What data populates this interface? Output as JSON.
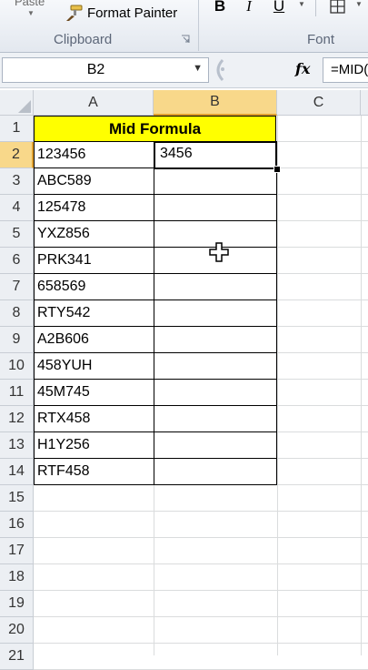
{
  "ribbon": {
    "paste_label": "Paste",
    "format_painter_label": "Format Painter",
    "clipboard_group_label": "Clipboard",
    "font_group_label": "Font",
    "bold_label": "B",
    "italic_label": "I",
    "underline_label": "U"
  },
  "formula_bar": {
    "name_box": "B2",
    "fx_label": "fx",
    "formula": "=MID("
  },
  "columns": [
    "A",
    "B",
    "C"
  ],
  "rows": [
    "1",
    "2",
    "3",
    "4",
    "5",
    "6",
    "7",
    "8",
    "9",
    "10",
    "11",
    "12",
    "13",
    "14",
    "15",
    "16",
    "17",
    "18",
    "19",
    "20",
    "21"
  ],
  "sheet": {
    "title": "Mid Formula",
    "column_a": [
      "123456",
      "ABC589",
      "125478",
      "YXZ856",
      "PRK341",
      "658569",
      "RTY542",
      "A2B606",
      "458YUH",
      "45M745",
      "RTX458",
      "H1Y256",
      "RTF458"
    ],
    "b2_value": "3456"
  },
  "colors": {
    "title_fill": "#ffff00",
    "selected_header": "#f8d88a"
  }
}
